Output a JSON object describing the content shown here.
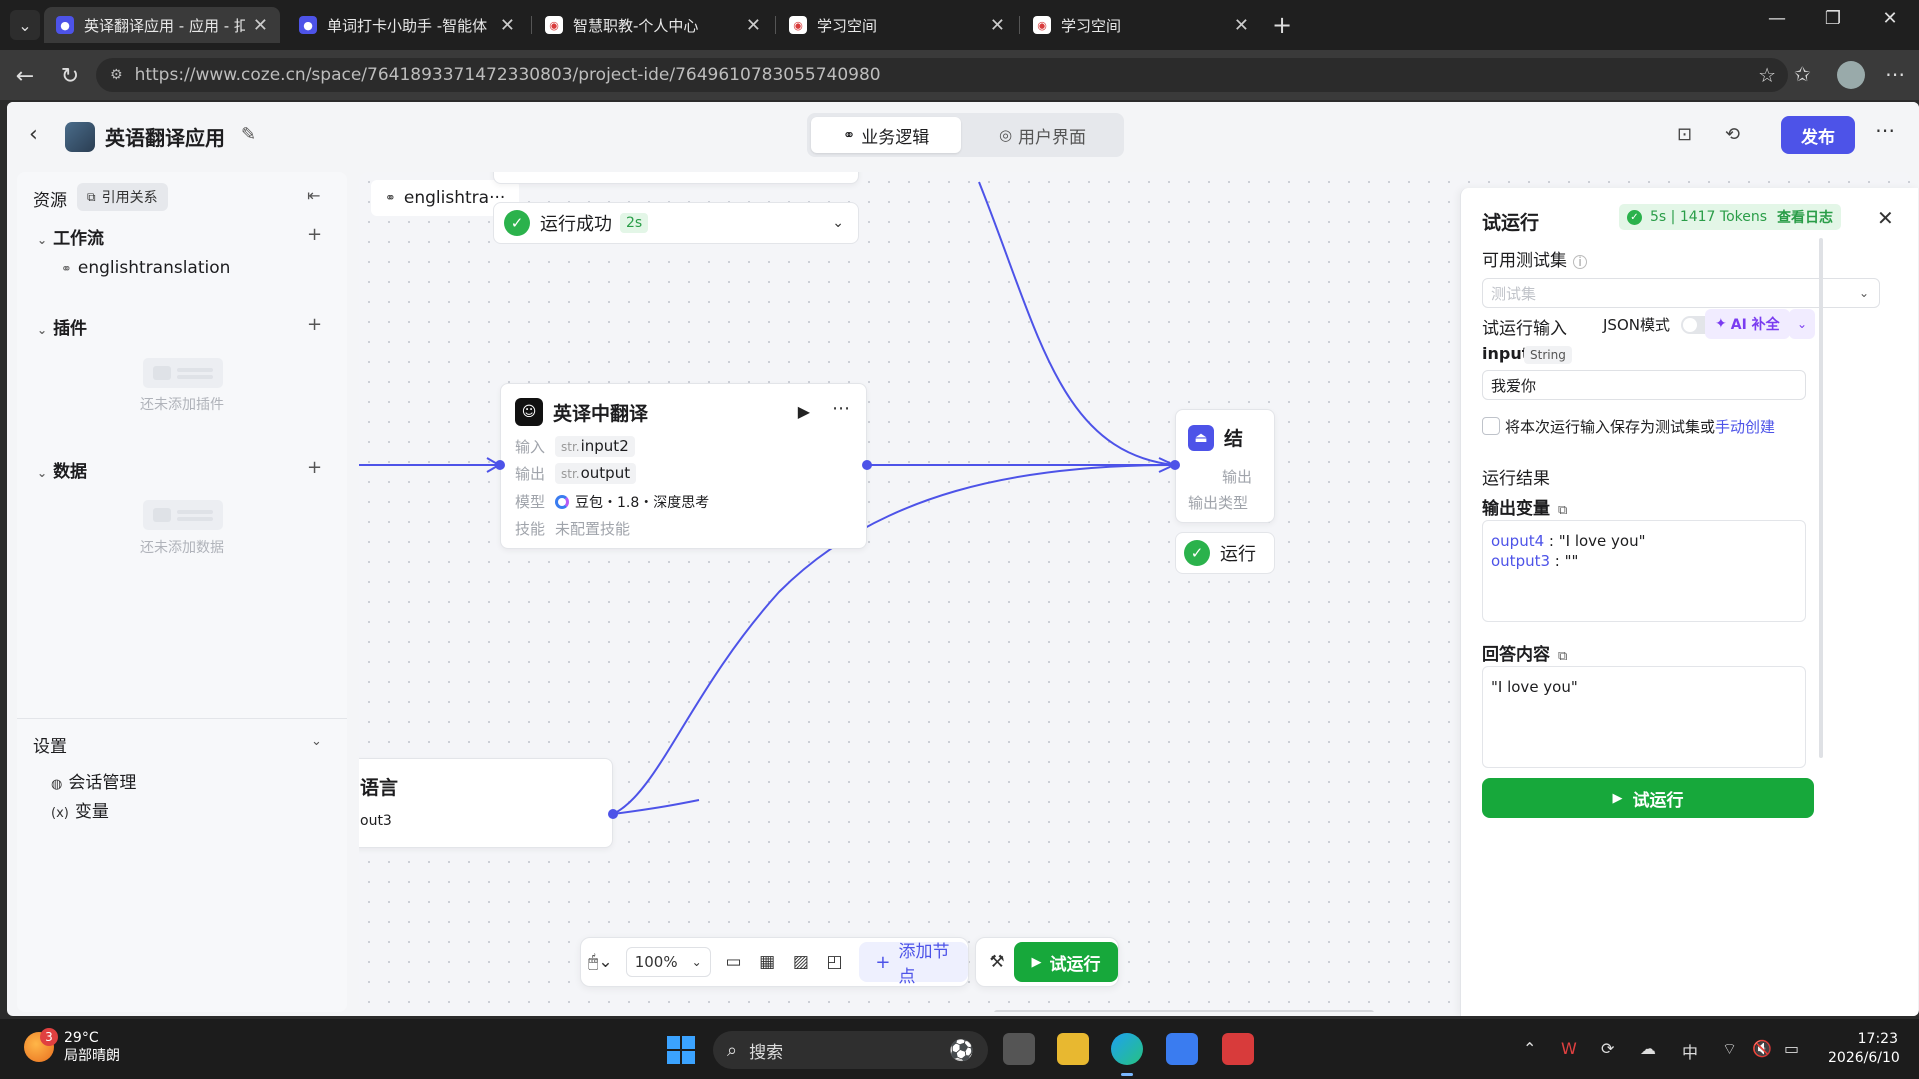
{
  "browser": {
    "tabs": [
      {
        "title": "英译翻译应用 - 应用 - 扣子",
        "active": true,
        "favicon_color": "#4d53e8"
      },
      {
        "title": "单词打卡小助手 -智能体 - 扣子",
        "active": false,
        "favicon_color": "#4d53e8"
      },
      {
        "title": "智慧职教-个人中心",
        "active": false,
        "favicon_color": "#d83b3b"
      },
      {
        "title": "学习空间",
        "active": false,
        "favicon_color": "#d83b3b"
      },
      {
        "title": "学习空间",
        "active": false,
        "favicon_color": "#d83b3b"
      }
    ],
    "url": "https://www.coze.cn/space/7641893371472330803/project-ide/7649610783055740980"
  },
  "app": {
    "title": "英语翻译应用",
    "mode_tabs": [
      {
        "label": "业务逻辑",
        "active": true
      },
      {
        "label": "用户界面",
        "active": false
      }
    ],
    "publish_label": "发布"
  },
  "sidebar": {
    "resources_label": "资源",
    "ref_label": "引用关系",
    "workflow": {
      "title": "工作流",
      "items": [
        "englishtranslation"
      ]
    },
    "plugins": {
      "title": "插件",
      "empty": "还未添加插件"
    },
    "data": {
      "title": "数据",
      "empty": "还未添加数据"
    },
    "settings": {
      "title": "设置",
      "items": [
        "会话管理",
        "变量"
      ]
    }
  },
  "canvas": {
    "tab_label": "englishtra···",
    "run_status_top": {
      "label": "运行成功",
      "time": "2s"
    },
    "node": {
      "title": "英译中翻译",
      "input_label": "输入",
      "input_var": "input2",
      "output_label": "输出",
      "output_var": "output",
      "type_prefix": "str.",
      "model_label": "模型",
      "model_value": "豆包・1.8・深度思考",
      "skill_label": "技能",
      "skill_value": "未配置技能"
    },
    "end_node": {
      "title_partial": "结",
      "out_label": "输出",
      "out_type_label": "输出类型",
      "run_partial": "运行"
    },
    "bottom_node": {
      "title_partial": "语言",
      "var_partial": "out3"
    },
    "toolbar": {
      "zoom": "100%",
      "add_node": "添加节点",
      "trial_run": "试运行"
    }
  },
  "panel": {
    "title": "试运行",
    "stats": "5s | 1417 Tokens",
    "log_link": "查看日志",
    "testset_label": "可用测试集",
    "testset_placeholder": "测试集",
    "trial_input_label": "试运行输入",
    "json_mode_label": "JSON模式",
    "ai_fill": "AI 补全",
    "input_name": "input",
    "input_type": "String",
    "input_value": "我爱你",
    "save_text": "将本次运行输入保存为测试集或",
    "save_link": "手动创建",
    "result_label": "运行结果",
    "output_vars_label": "输出变量",
    "outputs": [
      {
        "key": "ouput4",
        "value": " : \"I love you\""
      },
      {
        "key": "output3",
        "value": " : \"\""
      }
    ],
    "answer_label": "回答内容",
    "answer_value": "\"I love you\"",
    "run_button": "试运行"
  },
  "taskbar": {
    "weather_temp": "29°C",
    "weather_desc": "局部晴朗",
    "weather_badge": "3",
    "search_label": "搜索",
    "ime": "中",
    "time": "17:23",
    "date": "2026/6/10"
  }
}
